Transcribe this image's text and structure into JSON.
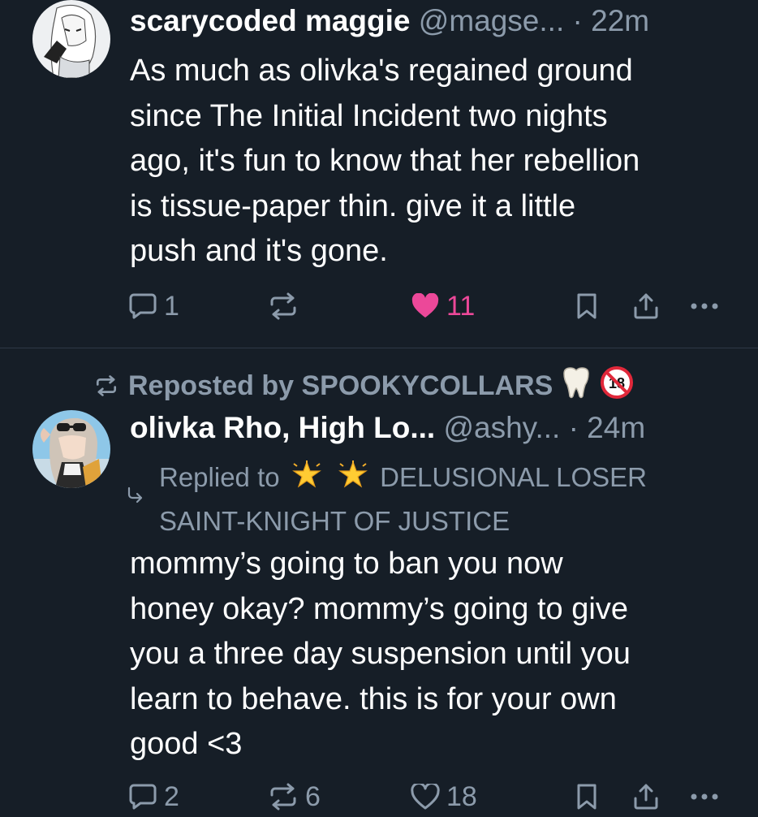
{
  "posts": [
    {
      "author": {
        "display_name": "scarycoded maggie",
        "handle": "@magse...",
        "time": "22m",
        "separator": "·"
      },
      "text": "As much as olivka's regained ground\nsince The Initial Incident two nights\nago, it's fun to know that her rebellion\nis tissue-paper thin. give it a little\npush and it's gone.",
      "actions": {
        "reply_count": "1",
        "repost_count": "",
        "like_count": "11",
        "liked": true
      }
    },
    {
      "reposted_by": "Reposted by SPOOKYCOLLARS",
      "author": {
        "display_name": "olivka Rho, High Lo...",
        "handle": "@ashy...",
        "time": "24m",
        "separator": "·"
      },
      "replied_to": {
        "prefix": "Replied to",
        "name_line1": "DELUSIONAL LOSER",
        "name_line2": "SAINT-KNIGHT OF JUSTICE"
      },
      "text": "mommy’s going to ban you now\nhoney okay? mommy’s going to give\nyou a three day suspension until you\nlearn to behave. this is for your own\ngood <3",
      "actions": {
        "reply_count": "2",
        "repost_count": "6",
        "like_count": "18",
        "liked": false
      }
    }
  ],
  "icons": {
    "reply": "speech-bubble-icon",
    "repost": "repost-arrows-icon",
    "like": "heart-icon",
    "bookmark": "bookmark-icon",
    "share": "share-icon",
    "more": "ellipsis-icon",
    "tooth": "tooth-emoji-icon",
    "no_under_18": "no-one-under-eighteen-icon",
    "sparkle_star": "glowing-star-icon"
  },
  "colors": {
    "background": "#161e27",
    "text": "#ffffff",
    "muted": "#8c9bab",
    "like_active": "#ec4899",
    "divider": "#2e3946"
  }
}
